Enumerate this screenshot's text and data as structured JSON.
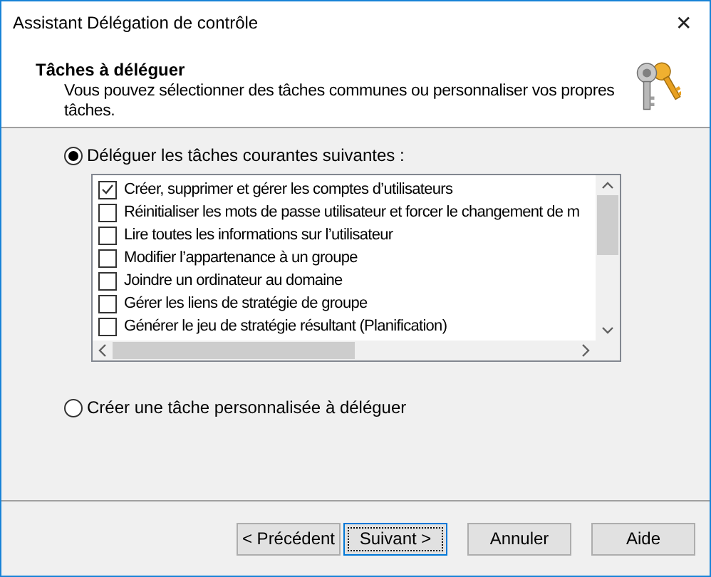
{
  "window": {
    "title": "Assistant Délégation de contrôle",
    "close": "✕"
  },
  "header": {
    "title": "Tâches à déléguer",
    "subtitle": "Vous pouvez sélectionner des tâches communes ou personnaliser vos propres tâches."
  },
  "options": [
    {
      "label": "Déléguer les tâches courantes suivantes :",
      "selected": true
    },
    {
      "label": "Créer une tâche personnalisée à déléguer",
      "selected": false
    }
  ],
  "tasks": [
    {
      "label": "Créer, supprimer et gérer les comptes d’utilisateurs",
      "checked": true
    },
    {
      "label": "Réinitialiser les mots de passe utilisateur et forcer le changement de m",
      "checked": false
    },
    {
      "label": "Lire toutes les informations sur l’utilisateur",
      "checked": false
    },
    {
      "label": "Modifier l’appartenance à un groupe",
      "checked": false
    },
    {
      "label": "Joindre un ordinateur au domaine",
      "checked": false
    },
    {
      "label": "Gérer les liens de stratégie de groupe",
      "checked": false
    },
    {
      "label": "Générer le jeu de stratégie résultant (Planification)",
      "checked": false
    }
  ],
  "buttons": [
    {
      "label": "< Précédent",
      "focused": false
    },
    {
      "label": "Suivant >",
      "focused": true
    },
    {
      "label": "Annuler",
      "focused": false
    },
    {
      "label": "Aide",
      "focused": false
    }
  ]
}
